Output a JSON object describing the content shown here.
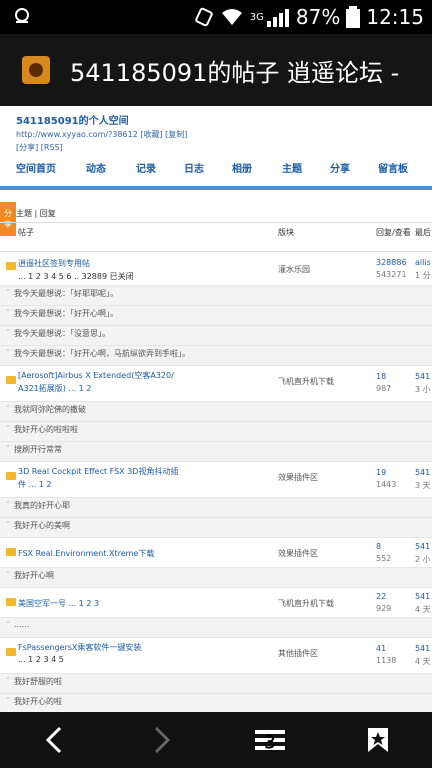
{
  "status": {
    "battery": "87%",
    "time": "12:15",
    "network": "3G"
  },
  "title": "541185091的帖子 逍遥论坛 -",
  "header": {
    "space_name": "541185091的个人空间",
    "url_line": "http://www.xyyao.com/?38612 [收藏] [复制]",
    "links_line": "[分享] [RSS]"
  },
  "nav": [
    "空间首页",
    "动态",
    "记录",
    "日志",
    "相册",
    "主题",
    "分享",
    "留言板"
  ],
  "share_tab": [
    "分",
    "享"
  ],
  "subnav": "主题 | 回复",
  "table_headers": {
    "subject": "帖子",
    "forum": "版块",
    "replies": "回复/查看",
    "last": "最后"
  },
  "rows": [
    {
      "type": "thread",
      "subject": "逍遥社区签到专用帖",
      "pages": "... 1 2 3 4 5 6 .. 32889 已关闭",
      "forum": "灌水乐园",
      "replies": "328886",
      "views": "543271",
      "last1": "ailis",
      "last2": "1 分"
    },
    {
      "type": "quote",
      "text": "我今天最想说：「好耶耶呢」。"
    },
    {
      "type": "quote",
      "text": "我今天最想说：「好开心啊」。"
    },
    {
      "type": "quote",
      "text": "我今天最想说：「没意思」。"
    },
    {
      "type": "quote",
      "text": "我今天最想说：「好开心啊，马航纵欲弄到手啦」。"
    },
    {
      "type": "thread2",
      "subject1": "[Aerosoft]Airbus X Extended(空客A320/",
      "subject2": "A321拓展版) ... 1 2",
      "forum": "飞机直升机下载",
      "replies": "18",
      "views": "987",
      "last1": "541",
      "last2": "3 小"
    },
    {
      "type": "quote",
      "text": "我就阿弥陀佛的撒破"
    },
    {
      "type": "quote",
      "text": "我好开心的啦啦啦"
    },
    {
      "type": "quote",
      "text": "搜刷开行常常"
    },
    {
      "type": "thread2",
      "subject1": "3D Real Cockpit Effect FSX 3D视角抖动插",
      "subject2": "件 ... 1 2",
      "forum": "效果插件区",
      "replies": "19",
      "views": "1443",
      "last1": "541",
      "last2": "3 天"
    },
    {
      "type": "quote",
      "text": "我真的好开心耶"
    },
    {
      "type": "quote",
      "text": "我好开心的美啊"
    },
    {
      "type": "thread",
      "subject": "FSX Real.Environment.Xtreme下载",
      "pages": "",
      "forum": "效果插件区",
      "replies": "8",
      "views": "552",
      "last1": "541",
      "last2": "2 小"
    },
    {
      "type": "quote",
      "text": "我好开心啊"
    },
    {
      "type": "thread",
      "subject": "美国空军一号 ... 1 2 3",
      "pages": "",
      "forum": "飞机直升机下载",
      "replies": "22",
      "views": "929",
      "last1": "541",
      "last2": "4 天"
    },
    {
      "type": "quote",
      "text": "......"
    },
    {
      "type": "thread",
      "subject": "FsPassengersX乘客软件一键安装",
      "pages": "... 1 2 3 4 5",
      "forum": "其他插件区",
      "replies": "41",
      "views": "1138",
      "last1": "541",
      "last2": "4 天"
    },
    {
      "type": "quote",
      "text": "我好舒服的啦"
    },
    {
      "type": "quote",
      "text": "我好开心的啦"
    }
  ],
  "bottom_nav": [
    "back-icon",
    "forward-icon",
    "menu-icon",
    "bookmark-icon"
  ]
}
